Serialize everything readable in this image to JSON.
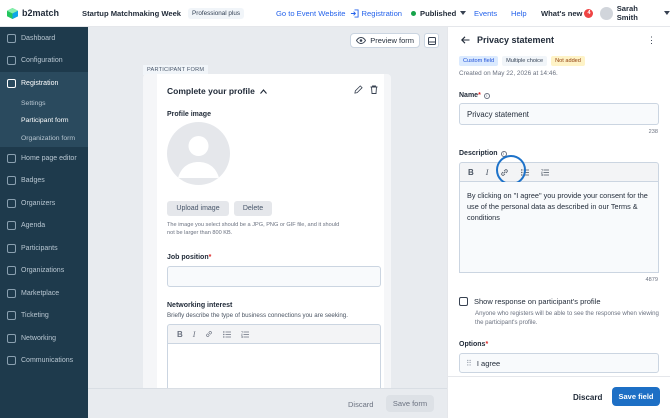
{
  "topbar": {
    "logo_text": "b2match",
    "event_name": "Startup Matchmaking Week",
    "plan_badge": "Professional plus",
    "go_to_event": "Go to Event Website",
    "registration_link": "Registration",
    "status": "Published",
    "events": "Events",
    "help": "Help",
    "whats_new": "What's new",
    "whats_new_count": "4",
    "user_name": "Sarah Smith",
    "accent_color": "#2563eb"
  },
  "sidebar": {
    "items": [
      {
        "label": "Dashboard",
        "icon": "dashboard-icon"
      },
      {
        "label": "Configuration",
        "icon": "config-icon"
      },
      {
        "label": "Registration",
        "icon": "registration-icon"
      },
      {
        "label": "Home page editor",
        "icon": "page-icon"
      },
      {
        "label": "Badges",
        "icon": "badge-icon"
      },
      {
        "label": "Organizers",
        "icon": "organizers-icon"
      },
      {
        "label": "Agenda",
        "icon": "agenda-icon"
      },
      {
        "label": "Participants",
        "icon": "participants-icon"
      },
      {
        "label": "Organizations",
        "icon": "organizations-icon"
      },
      {
        "label": "Marketplace",
        "icon": "marketplace-icon"
      },
      {
        "label": "Ticketing",
        "icon": "ticketing-icon"
      },
      {
        "label": "Networking",
        "icon": "networking-icon"
      },
      {
        "label": "Communications",
        "icon": "communications-icon"
      }
    ],
    "sub_items": [
      "Settings",
      "Participant form",
      "Organization form"
    ],
    "bg_color": "#1e3a4c"
  },
  "canvas": {
    "preview_form": "Preview form",
    "tag": "PARTICIPANT FORM",
    "section_title": "Complete your profile",
    "profile_image_label": "Profile image",
    "upload_image": "Upload image",
    "delete": "Delete",
    "image_hint": "The image you select should be a JPG, PNG or GIF file, and it should not be larger than 800 KB.",
    "job_position_label": "Job position",
    "networking_label": "Networking interest",
    "networking_hint": "Briefly describe the type of business connections you are seeking.",
    "discard": "Discard",
    "save_form": "Save form"
  },
  "panel": {
    "title": "Privacy statement",
    "tags": [
      "Custom field",
      "Multiple choice",
      "Not added"
    ],
    "created": "Created on May 22, 2026 at 14:46.",
    "name_label": "Name",
    "name_value": "Privacy statement",
    "name_counter": "238",
    "description_label": "Description",
    "description_value": "By clicking on \"I agree\" you provide your consent for the use of the personal data as described in our Terms & conditions",
    "description_counter": "4879",
    "show_response_label": "Show response on participant's profile",
    "show_response_hint": "Anyone who registers will be able to see the response when viewing the participant's profile.",
    "options_label": "Options",
    "option_1": "I agree",
    "discard": "Discard",
    "save_field": "Save field",
    "save_color": "#1d6fc5"
  }
}
